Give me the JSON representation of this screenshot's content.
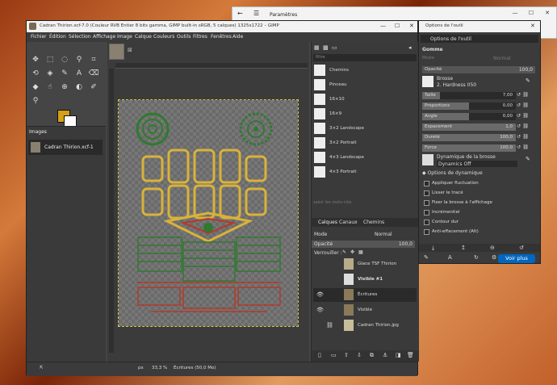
{
  "settings_window": {
    "title": "Paramètres",
    "back": "←",
    "menu": "☰",
    "minimize": "—",
    "maximize": "☐",
    "close": "✕"
  },
  "gimp": {
    "title": "Cadran Thirion.xcf-7.0 (Couleur RVB Entier 8 bits gamma, GIMP built-in sRGB, 5 calques) 1325x1722 – GIMP",
    "menu": [
      "Fichier",
      "Édition",
      "Sélection",
      "Affichage",
      "Image",
      "Calque",
      "Couleurs",
      "Outils",
      "Filtres",
      "Fenêtres",
      "Aide"
    ],
    "images_tab": "Images",
    "images": [
      {
        "name": "Cadran Thirion.xcf-1"
      }
    ],
    "status": {
      "unit": "px",
      "zoom": "33,3 %",
      "info": "Écritures (50,0 Mo)"
    }
  },
  "brushes": {
    "filter_placeholder": "filtre",
    "items": [
      "Chemins",
      "Pinceau",
      "16×10",
      "16×9",
      "3×2 Landscape",
      "3×2 Portrait",
      "4×3 Landscape",
      "4×3 Portrait"
    ],
    "tag_placeholder": "saisir les mots-clés"
  },
  "layers": {
    "tabs": [
      "Calques",
      "Canaux",
      "Chemins"
    ],
    "mode_label": "Mode",
    "mode_value": "Normal",
    "opacity_label": "Opacité",
    "opacity_value": "100,0",
    "lock_label": "Verrouiller :",
    "items": [
      {
        "name": "Glace TSF Thirion",
        "visible": false
      },
      {
        "name": "Visible #1",
        "visible": false
      },
      {
        "name": "Écritures",
        "visible": true
      },
      {
        "name": "Visible",
        "visible": true
      },
      {
        "name": "Cadran Thirion.jpg",
        "visible": false
      }
    ]
  },
  "tool_options": {
    "window_title": "Options de l'outil",
    "tab": "Options de l'outil",
    "tool_name": "Gomme",
    "mode_label": "Mode",
    "mode_value": "Normal",
    "opacity_label": "Opacité",
    "opacity_value": "100,0",
    "brush_label": "Brosse",
    "brush_value": "2. Hardness 050",
    "params": [
      {
        "label": "Taille",
        "value": "7,00"
      },
      {
        "label": "Proportions",
        "value": "0,00"
      },
      {
        "label": "Angle",
        "value": "0,00"
      },
      {
        "label": "Espacement",
        "value": "1,0"
      },
      {
        "label": "Dureté",
        "value": "100,0"
      },
      {
        "label": "Force",
        "value": "100,0"
      }
    ],
    "dynamics_label": "Dynamique de la brosse",
    "dynamics_value": "Dynamics Off",
    "dynamics_options": "Options de dynamique",
    "checkboxes": [
      "Appliquer fluctuation",
      "Lisser le tracé",
      "Fixer la brosse à l'affichage",
      "Incrémentiel",
      "Contour dur",
      "Anti-effacement (Alt)"
    ],
    "bottom_button": "Voir plus"
  }
}
